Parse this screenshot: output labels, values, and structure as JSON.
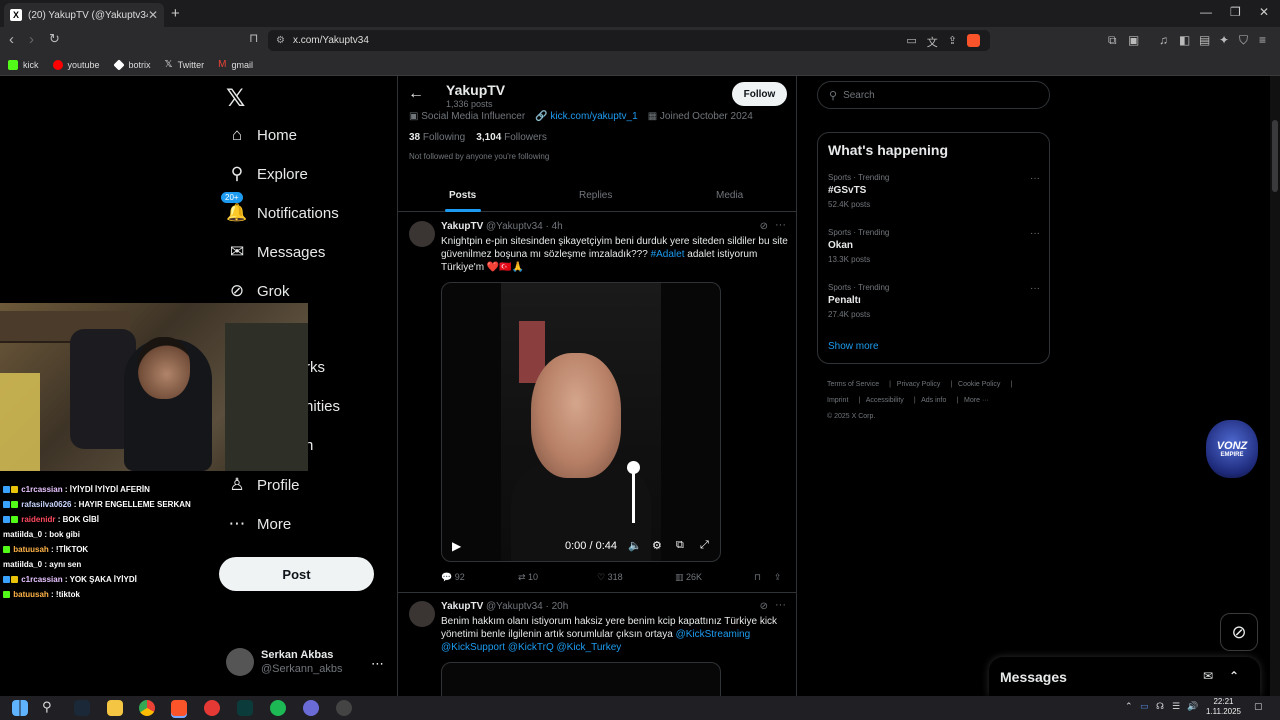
{
  "browser": {
    "tab_title": "(20) YakupTV (@Yakuptv34) / X",
    "tab_favicon": "X",
    "url": "x.com/Yakuptv34",
    "bookmarks": [
      {
        "label": "kick",
        "color": "#53fc18"
      },
      {
        "label": "youtube",
        "color": "#ff0000"
      },
      {
        "label": "botrix",
        "color": "#ffffff"
      },
      {
        "label": "Twitter",
        "color": "#dddddd"
      },
      {
        "label": "gmail",
        "color": "#ea4335"
      }
    ]
  },
  "sidebar": {
    "logo": "𝕏",
    "items": [
      {
        "label": "Home",
        "icon": "⌂"
      },
      {
        "label": "Explore",
        "icon": "⚲"
      },
      {
        "label": "Notifications",
        "icon": "🔔"
      },
      {
        "label": "Messages",
        "icon": "✉"
      },
      {
        "label": "Grok",
        "icon": "⊘"
      },
      {
        "label": "rks",
        "icon": ""
      },
      {
        "label": "nities",
        "icon": ""
      },
      {
        "label": "n",
        "icon": ""
      },
      {
        "label": "Profile",
        "icon": "♙"
      },
      {
        "label": "More",
        "icon": "⋯"
      }
    ],
    "notif_badge": "20+",
    "post_label": "Post",
    "account": {
      "name": "Serkan Akbas",
      "handle": "@Serkann_akbs"
    }
  },
  "profile": {
    "name": "YakupTV",
    "posts_count": "1,336 posts",
    "follow_label": "Follow",
    "category": "Social Media Influencer",
    "link": "kick.com/yakuptv_1",
    "joined": "Joined October 2024",
    "following_count": "38",
    "following_label": "Following",
    "followers_count": "3,104",
    "followers_label": "Followers",
    "not_followed": "Not followed by anyone you're following",
    "tabs": [
      "Posts",
      "Replies",
      "Media"
    ]
  },
  "tweets": [
    {
      "author": "YakupTV",
      "handle": "@Yakuptv34",
      "time": "4h",
      "text_main": "Knightpin e-pin sitesinden şikayetçiyim beni durduk yere siteden sildiler bu site güvenilmez boşuna mı sözleşme imzaladık???",
      "hashtag": "#Adalet",
      "text_tail": "adalet istiyorum Türkiye'm ❤️🇹🇷🙏",
      "video_time": "0:00 / 0:44",
      "replies": "92",
      "reposts": "10",
      "likes": "318",
      "views": "26K"
    },
    {
      "author": "YakupTV",
      "handle": "@Yakuptv34",
      "time": "20h",
      "text_main": "Benim hakkım olanı istiyorum haksiz yere benim kcip kapattınız Türkiye kick yönetimi benle ilgilenin artık sorumlular çıksın ortaya",
      "mentions": "@KickStreaming @KickSupport @KickTrQ @Kick_Turkey"
    }
  ],
  "right": {
    "search_placeholder": "Search",
    "happening_title": "What's happening",
    "trends": [
      {
        "category": "Sports · Trending",
        "name": "#GSvTS",
        "count": "52.4K posts"
      },
      {
        "category": "Sports · Trending",
        "name": "Okan",
        "count": "13.3K posts"
      },
      {
        "category": "Sports · Trending",
        "name": "Penaltı",
        "count": "27.4K posts"
      }
    ],
    "show_more": "Show more",
    "footer_line1": [
      "Terms of Service",
      "Privacy Policy",
      "Cookie Policy"
    ],
    "footer_line2": [
      "Imprint",
      "Accessibility",
      "Ads info",
      "More ···"
    ],
    "copyright": "© 2025 X Corp.",
    "messages_label": "Messages"
  },
  "overlay": {
    "logo_main": "VONZ",
    "logo_sub": "EMPIRE",
    "chat": [
      {
        "user": "c1rcassian",
        "msg": "İYİYDİ İYİYDİ AFERİN",
        "color": "#e7c3ff"
      },
      {
        "user": "rafasilva0626",
        "msg": "HAYIR ENGELLEME SERKAN",
        "color": "#c8d6ff"
      },
      {
        "user": "raidenidr",
        "msg": "BOK GİBİ",
        "color": "#ff4a5e"
      },
      {
        "user": "matiilda_0",
        "msg": "bok gibi",
        "color": "#ffffff"
      },
      {
        "user": "batuusah",
        "msg": "!TİKTOK",
        "color": "#ffb347"
      },
      {
        "user": "matiilda_0",
        "msg": "aynı sen",
        "color": "#ffffff"
      },
      {
        "user": "c1rcassian",
        "msg": "YOK ŞAKA İYİYDİ",
        "color": "#e7c3ff"
      },
      {
        "user": "batuusah",
        "msg": "!tiktok",
        "color": "#ffb347"
      }
    ]
  },
  "taskbar": {
    "time": "22:21",
    "date": "1.11.2025"
  }
}
